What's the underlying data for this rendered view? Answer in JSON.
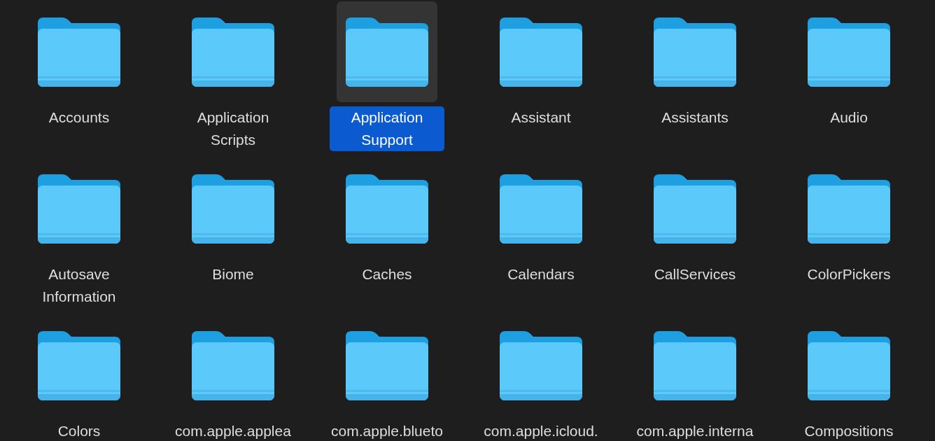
{
  "folders": [
    {
      "name": "Accounts",
      "selected": false
    },
    {
      "name": "Application Scripts",
      "selected": false
    },
    {
      "name": "Application Support",
      "selected": true
    },
    {
      "name": "Assistant",
      "selected": false
    },
    {
      "name": "Assistants",
      "selected": false
    },
    {
      "name": "Audio",
      "selected": false
    },
    {
      "name": "Autosave Information",
      "selected": false
    },
    {
      "name": "Biome",
      "selected": false
    },
    {
      "name": "Caches",
      "selected": false
    },
    {
      "name": "Calendars",
      "selected": false
    },
    {
      "name": "CallServices",
      "selected": false
    },
    {
      "name": "ColorPickers",
      "selected": false
    },
    {
      "name": "Colors",
      "selected": false
    },
    {
      "name": "com.apple.applea",
      "selected": false
    },
    {
      "name": "com.apple.blueto",
      "selected": false
    },
    {
      "name": "com.apple.icloud.",
      "selected": false
    },
    {
      "name": "com.apple.interna",
      "selected": false
    },
    {
      "name": "Compositions",
      "selected": false
    }
  ]
}
